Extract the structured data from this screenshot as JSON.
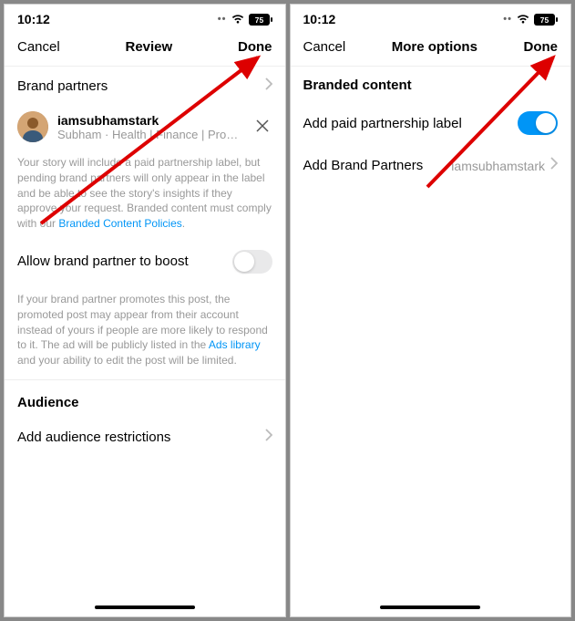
{
  "status": {
    "time": "10:12",
    "battery": "75"
  },
  "left": {
    "nav": {
      "cancel": "Cancel",
      "title": "Review",
      "done": "Done"
    },
    "brandPartnersLabel": "Brand partners",
    "partner": {
      "username": "iamsubhamstark",
      "subtitle": "Subham · Health | Finance | Productivity ·…"
    },
    "storyDesc1": "Your story will include a paid partnership label, but pending brand partners will only appear in the label and be able to see the story's insights if they approve your request. Branded content must comply with our ",
    "storyDescLink": "Branded Content Policies",
    "allowBoostLabel": "Allow brand partner to boost",
    "boostDesc1": "If your brand partner promotes this post, the promoted post may appear from their account instead of yours if people are more likely to respond to it. The ad will be publicly listed in the ",
    "boostDescLink": "Ads library",
    "boostDesc2": " and your ability to edit the post will be limited.",
    "audienceHeader": "Audience",
    "audienceLabel": "Add audience restrictions"
  },
  "right": {
    "nav": {
      "cancel": "Cancel",
      "title": "More options",
      "done": "Done"
    },
    "brandedContentHeader": "Branded content",
    "paidLabelText": "Add paid partnership label",
    "addBrandPartnersLabel": "Add Brand Partners",
    "addBrandPartnersValue": "iamsubhamstark"
  }
}
